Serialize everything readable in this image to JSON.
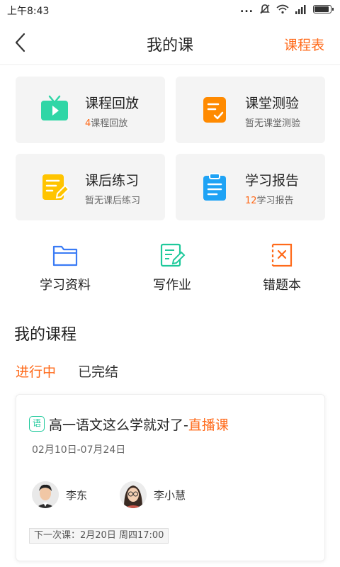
{
  "status_bar": {
    "time": "上午8:43",
    "dots": "..."
  },
  "nav": {
    "title": "我的课",
    "schedule_label": "课程表"
  },
  "cards": [
    {
      "title": "课程回放",
      "sub_num": "4",
      "sub_text": "课程回放",
      "icon": "tv-icon",
      "color": "#2fd6a6"
    },
    {
      "title": "课堂测验",
      "sub_num": "",
      "sub_text": "暂无课堂测验",
      "icon": "quiz-icon",
      "color": "#ff8a00"
    },
    {
      "title": "课后练习",
      "sub_num": "",
      "sub_text": "暂无课后练习",
      "icon": "exercise-icon",
      "color": "#ffc400"
    },
    {
      "title": "学习报告",
      "sub_num": "12",
      "sub_text": "学习报告",
      "icon": "clipboard-icon",
      "color": "#1fa3f5"
    }
  ],
  "tools": [
    {
      "label": "学习资料",
      "icon": "folder-icon",
      "color": "#3a7bf5"
    },
    {
      "label": "写作业",
      "icon": "homework-icon",
      "color": "#1ec99b"
    },
    {
      "label": "错题本",
      "icon": "mistake-book-icon",
      "color": "#ff6a1a"
    }
  ],
  "section_title": "我的课程",
  "tabs": [
    {
      "label": "进行中",
      "active": true
    },
    {
      "label": "已完结",
      "active": false
    }
  ],
  "course": {
    "subject_badge": "语",
    "title": "高一语文这么学就对了-",
    "type": "直播课",
    "dates": "02月10日-07月24日",
    "teachers": [
      "李东",
      "李小慧"
    ],
    "next_class": "下一次课：2月20日  周四17:00"
  },
  "colors": {
    "accent": "#ff6a1a",
    "card_bg": "#f4f4f4"
  }
}
